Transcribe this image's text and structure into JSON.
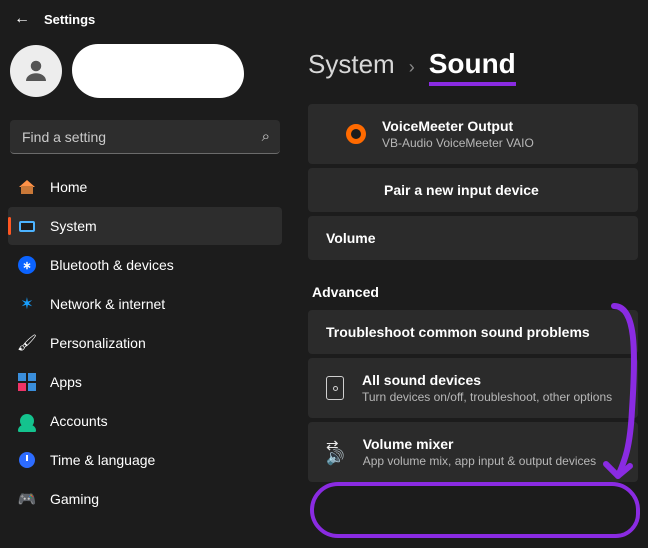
{
  "app": {
    "title": "Settings"
  },
  "search": {
    "placeholder": "Find a setting"
  },
  "nav": {
    "items": [
      {
        "label": "Home"
      },
      {
        "label": "System"
      },
      {
        "label": "Bluetooth & devices"
      },
      {
        "label": "Network & internet"
      },
      {
        "label": "Personalization"
      },
      {
        "label": "Apps"
      },
      {
        "label": "Accounts"
      },
      {
        "label": "Time & language"
      },
      {
        "label": "Gaming"
      }
    ]
  },
  "breadcrumb": {
    "parent": "System",
    "current": "Sound"
  },
  "sound": {
    "voicemeeter": {
      "title": "VoiceMeeter Output",
      "subtitle": "VB-Audio VoiceMeeter VAIO"
    },
    "pair_label": "Pair a new input device",
    "volume_label": "Volume",
    "advanced_label": "Advanced",
    "troubleshoot_label": "Troubleshoot common sound problems",
    "all_devices": {
      "title": "All sound devices",
      "subtitle": "Turn devices on/off, troubleshoot, other options"
    },
    "mixer": {
      "title": "Volume mixer",
      "subtitle": "App volume mix, app input & output devices"
    }
  },
  "colors": {
    "accent": "#8a2be2"
  }
}
